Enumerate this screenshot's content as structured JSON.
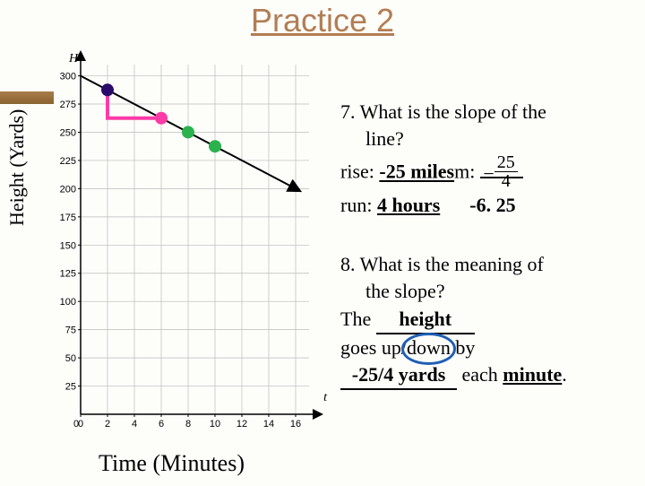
{
  "title": "Practice 2",
  "labels": {
    "ylabel": "Height (Yards)",
    "xlabel": "Time (Minutes)",
    "yAxisLetter": "H",
    "xAxisLetter": "t"
  },
  "chart_data": {
    "type": "line",
    "title": "",
    "xlabel": "Time (Minutes)",
    "ylabel": "Height (Yards)",
    "xlim": [
      0,
      17
    ],
    "ylim": [
      0,
      310
    ],
    "x_ticks": [
      0,
      2,
      4,
      6,
      8,
      10,
      12,
      14,
      16
    ],
    "y_ticks": [
      25,
      50,
      75,
      100,
      125,
      150,
      175,
      200,
      225,
      250,
      275,
      300
    ],
    "series": [
      {
        "name": "line",
        "x": [
          0,
          16
        ],
        "y": [
          300,
          200
        ]
      }
    ],
    "markers_rise_run": {
      "from": [
        2,
        287.5
      ],
      "to": [
        6,
        262.5
      ],
      "extra_points_x": [
        8,
        10
      ],
      "style": "pink-path-green-points"
    }
  },
  "q7": {
    "prompt_line1": "7.  What is the slope of the",
    "prompt_line2": "line?",
    "rise_label": "rise:",
    "rise_value": "-25 miles",
    "m_label": "m:",
    "m_frac_num": "25",
    "m_frac_den": "4",
    "run_label": "run:",
    "run_value": "4 hours",
    "m_decimal": "-6. 25"
  },
  "q8": {
    "prompt_line1": "8.  What is the meaning of",
    "prompt_line2": "the slope?",
    "the": "The",
    "blank1": "height",
    "goes": "goes up/",
    "down": "down",
    "by": " by",
    "blank2": "-25/4 yards",
    "each": "each",
    "unit": "minute",
    "period": "."
  }
}
